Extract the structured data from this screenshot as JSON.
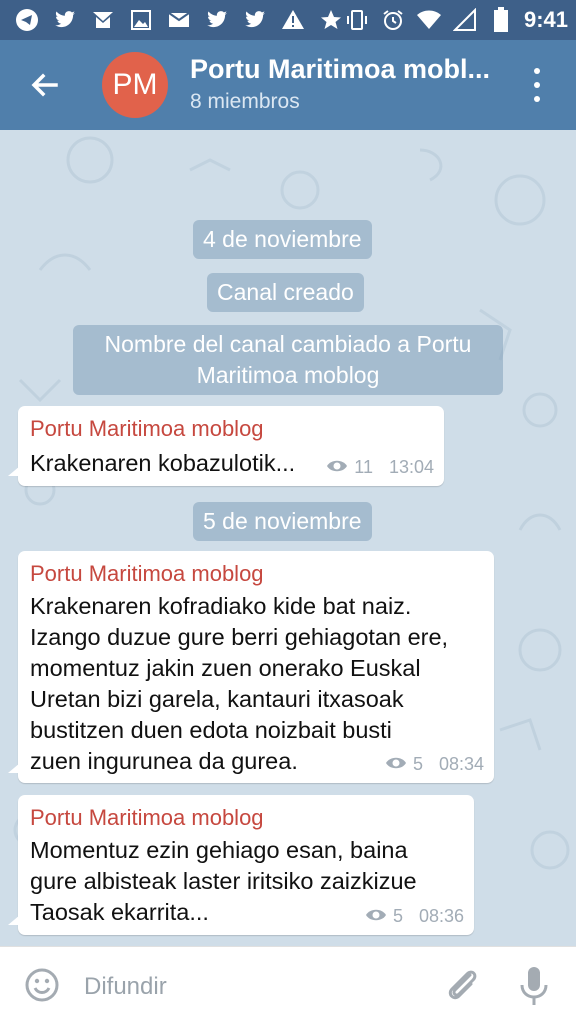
{
  "status_bar": {
    "time": "9:41",
    "icons": [
      "telegram-icon",
      "twitter-icon",
      "gmail-icon",
      "image-icon",
      "mail-icon",
      "twitter-icon",
      "twitter-icon",
      "warning-icon",
      "star-icon",
      "vibrate-icon",
      "alarm-icon",
      "wifi-icon",
      "signal-icon",
      "battery-icon"
    ]
  },
  "header": {
    "avatar_initials": "PM",
    "avatar_color": "#e1624b",
    "title": "Portu Maritimoa mobl...",
    "subtitle": "8 miembros"
  },
  "messages": {
    "date1": "4 de noviembre",
    "service1": "Canal creado",
    "service2_line1": "Nombre del canal cambiado a Portu",
    "service2_line2": "Maritimoa moblog",
    "msg1": {
      "sender": "Portu Maritimoa moblog",
      "text": "Krakenaren kobazulotik...",
      "views": "11",
      "time": "13:04"
    },
    "date2": "5 de noviembre",
    "msg2": {
      "sender": "Portu Maritimoa moblog",
      "lines": [
        "Krakenaren kofradiako kide bat naiz.",
        "Izango duzue gure berri gehiagotan ere,",
        "momentuz jakin zuen onerako Euskal",
        "Uretan bizi garela, kantauri itxasoak",
        "bustitzen duen edota noizbait busti",
        "zuen ingurunea da gurea."
      ],
      "views": "5",
      "time": "08:34"
    },
    "msg3": {
      "sender": "Portu Maritimoa moblog",
      "lines": [
        "Momentuz ezin gehiago esan, baina",
        "gure albisteak laster iritsiko zaizkizue",
        "Taosak ekarrita..."
      ],
      "views": "5",
      "time": "08:36"
    }
  },
  "composer": {
    "placeholder": "Difundir"
  },
  "colors": {
    "status_bar": "#3e6089",
    "app_bar": "#507fab",
    "sender_name": "#c6483f",
    "chat_background": "#cfdde8"
  }
}
